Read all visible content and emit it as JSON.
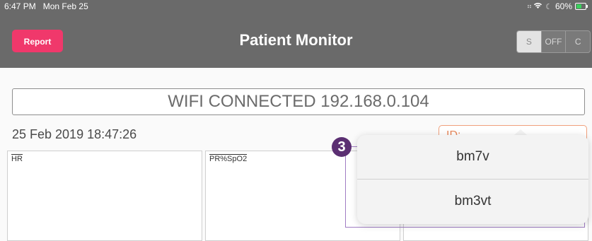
{
  "status_bar": {
    "time": "6:47 PM",
    "date": "Mon Feb 25",
    "battery_percent": "60%",
    "icons": [
      "signal-icon",
      "wifi-icon",
      "moon-icon",
      "battery-charging-icon"
    ]
  },
  "nav": {
    "report_label": "Report",
    "title": "Patient Monitor",
    "segments": [
      "S",
      "OFF",
      "C"
    ],
    "selected_segment": "S"
  },
  "banner": {
    "wifi_text": "WIFI CONNECTED 192.168.0.104"
  },
  "datetime": "25 Feb 2019 18:47:26",
  "id_field": {
    "label": "ID:"
  },
  "panels": [
    {
      "label": "HR"
    },
    {
      "label": "PR%SpO2"
    },
    {
      "label": ""
    }
  ],
  "callout": {
    "number": "3"
  },
  "popover": {
    "options": [
      "bm7v",
      "bm3vt"
    ]
  },
  "colors": {
    "header_bg": "#6a6a6a",
    "report_button": "#f0386b",
    "id_accent": "#e8885b",
    "callout": "#5b2f72"
  }
}
